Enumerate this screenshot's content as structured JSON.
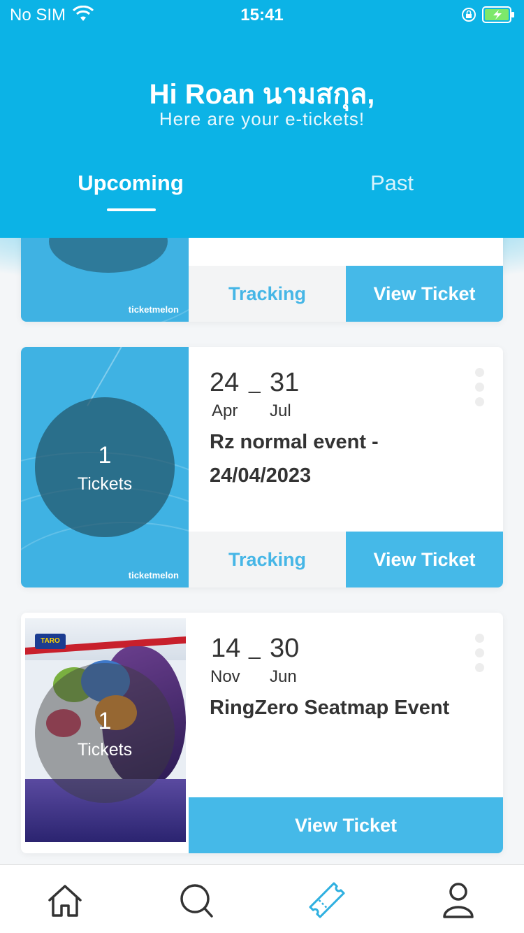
{
  "status_bar": {
    "carrier": "No SIM",
    "time": "15:41"
  },
  "header": {
    "greeting": "Hi Roan นามสกุล,",
    "subtitle": "Here are your e-tickets!",
    "tabs": [
      {
        "label": "Upcoming",
        "active": true
      },
      {
        "label": "Past",
        "active": false
      }
    ]
  },
  "cards": [
    {
      "brand": "ticketmelon",
      "tracking_label": "Tracking",
      "view_label": "View Ticket"
    },
    {
      "brand": "ticketmelon",
      "ticket_count": "1",
      "tickets_label": "Tickets",
      "start_day": "24",
      "start_month": "Apr",
      "separator": "_",
      "end_day": "31",
      "end_month": "Jul",
      "title": "Rz normal event - 24/04/2023",
      "tracking_label": "Tracking",
      "view_label": "View Ticket"
    },
    {
      "ticket_count": "1",
      "tickets_label": "Tickets",
      "start_day": "14",
      "start_month": "Nov",
      "separator": "_",
      "end_day": "30",
      "end_month": "Jun",
      "title": "RingZero Seatmap Event",
      "view_label": "View Ticket",
      "poster_brand": "TARO"
    }
  ],
  "tabbar": {
    "items": [
      "home-icon",
      "search-icon",
      "ticket-icon",
      "profile-icon"
    ],
    "active": "ticket-icon"
  },
  "colors": {
    "primary": "#0cb3e6",
    "button": "#45b9e8",
    "tracking_text": "#46b6e6"
  }
}
